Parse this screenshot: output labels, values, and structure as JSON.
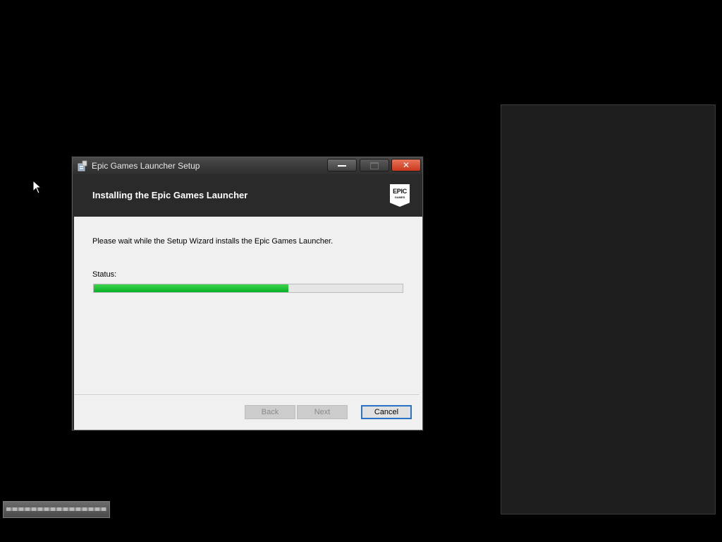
{
  "window": {
    "title": "Epic Games Launcher Setup",
    "close_glyph": "✕"
  },
  "header": {
    "title": "Installing the Epic Games Launcher",
    "logo_line1": "EPIC",
    "logo_line2": "GAMES"
  },
  "main": {
    "description": "Please wait while the Setup Wizard installs the Epic Games Launcher.",
    "status_label": "Status:",
    "progress_fraction": 0.63
  },
  "buttons": {
    "back_label": "Back",
    "next_label": "Next",
    "cancel_label": "Cancel"
  },
  "colors": {
    "progress": "#07b025",
    "cancel_border": "#2b73c4",
    "close_button": "#c9381c"
  }
}
